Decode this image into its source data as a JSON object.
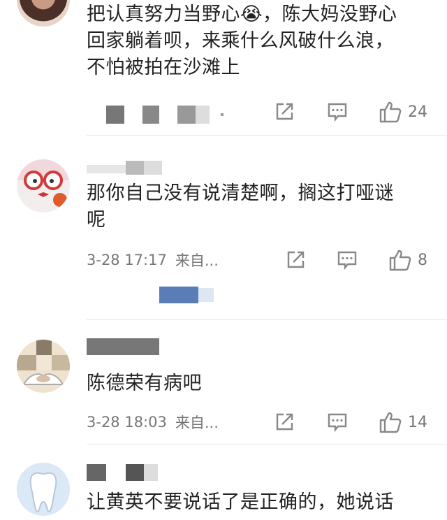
{
  "comments": [
    {
      "text_line1": "把认真努力当野心😭，陈大妈没野心",
      "text_line2": "回家躺着呗，来乘什么风破什么浪，",
      "text_line3": "不怕被拍在沙滩上",
      "likes": "24"
    },
    {
      "text_line1": "那你自己没有说清楚啊，搁这打哑谜",
      "text_line2": "呢",
      "time": "3-28 17:17",
      "source": "来自...",
      "likes": "8"
    },
    {
      "text_line1": "陈德荣有病吧",
      "time": "3-28 18:03",
      "source": "来自...",
      "likes": "14"
    },
    {
      "text_line1": "让黄英不要说话了是正确的，她说话"
    }
  ],
  "icons": {
    "share": "share-icon",
    "comment": "comment-icon",
    "like": "thumbs-up-icon"
  },
  "colors": {
    "text": "#222222",
    "meta": "#777777",
    "icon": "#888888"
  }
}
